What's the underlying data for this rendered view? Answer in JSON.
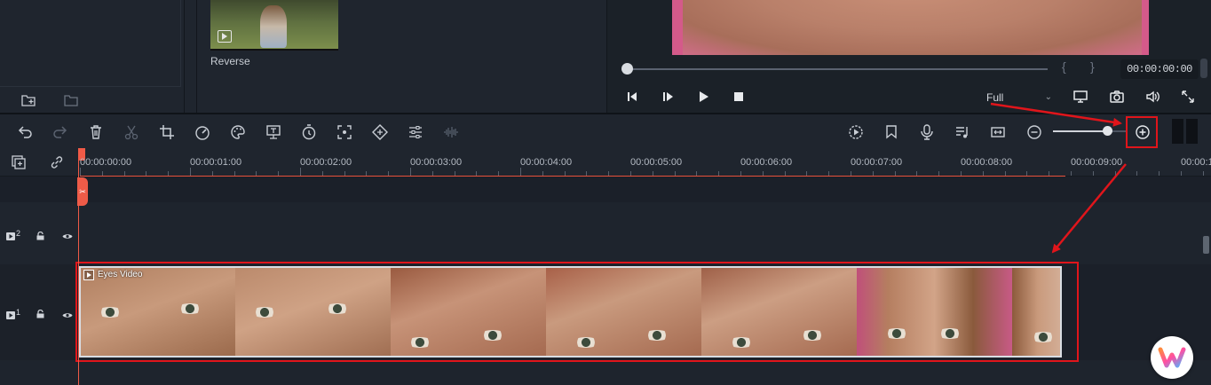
{
  "media": {
    "thumbnail_label": "Reverse"
  },
  "preview": {
    "timecode": "00:00:00:00",
    "mark_in_glyph": "{",
    "mark_out_glyph": "}",
    "quality": "Full"
  },
  "toolbar": {
    "left_icons": [
      "undo-icon",
      "redo-icon",
      "delete-icon",
      "scissors-icon",
      "crop-icon",
      "speed-icon",
      "color-icon",
      "green-screen-icon",
      "duration-icon",
      "stabilize-icon",
      "keyframe-icon",
      "adjust-icon",
      "audio-wave-icon"
    ],
    "right_icons": [
      "render-preview-icon",
      "marker-icon",
      "mic-icon",
      "music-list-icon",
      "fit-icon",
      "zoom-out-icon",
      "zoom-in-icon"
    ]
  },
  "ruler": {
    "ticks": [
      "00:00:00:00",
      "00:00:01:00",
      "00:00:02:00",
      "00:00:03:00",
      "00:00:04:00",
      "00:00:05:00",
      "00:00:06:00",
      "00:00:07:00",
      "00:00:08:00",
      "00:00:09:00",
      "00:00:1"
    ]
  },
  "tracks": [
    {
      "number": "2"
    },
    {
      "number": "1"
    }
  ],
  "clip": {
    "title": "Eyes Video"
  },
  "colors": {
    "accent_red": "#e0151b",
    "playhead": "#f05a47"
  }
}
